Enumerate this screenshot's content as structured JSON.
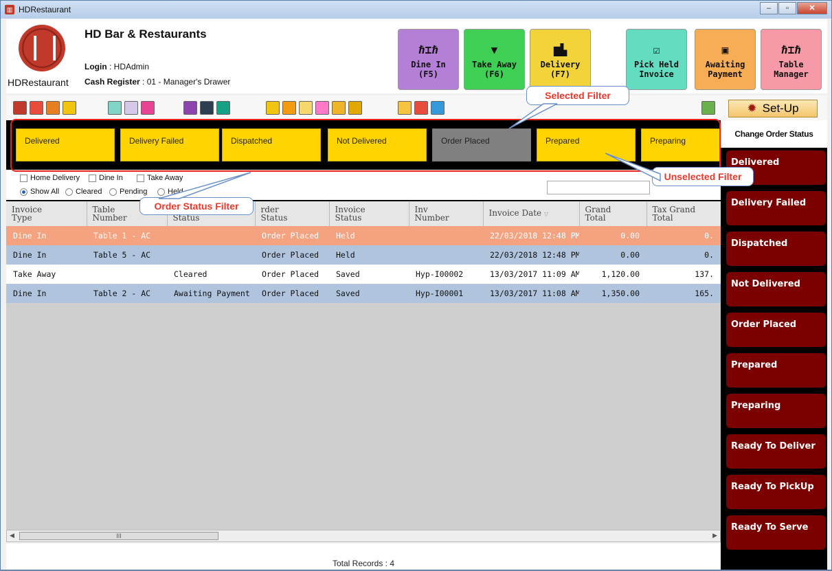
{
  "window": {
    "title": "HDRestaurant",
    "controls": [
      "minimize",
      "maximize",
      "close"
    ]
  },
  "header": {
    "brand": "HDRestaurant",
    "name": "HD Bar & Restaurants",
    "login_label": "Login",
    "login_value": ": HDAdmin",
    "register_label": "Cash Register",
    "register_value": ": 01 - Manager's Drawer",
    "buttons": [
      {
        "line1": "Dine In",
        "line2": "(F5)",
        "color": "#b47fd6",
        "icon": "table-icon"
      },
      {
        "line1": "Take Away",
        "line2": "(F6)",
        "color": "#3fcf54",
        "icon": "cup-icon"
      },
      {
        "line1": "Delivery",
        "line2": "(F7)",
        "color": "#f2d33a",
        "icon": "truck-icon"
      },
      {
        "line1": "Pick Held",
        "line2": "Invoice",
        "color": "#63dcc0",
        "icon": "note-icon"
      },
      {
        "line1": "Awaiting",
        "line2": "Payment",
        "color": "#f6ad56",
        "icon": "wallet-icon"
      },
      {
        "line1": "Table",
        "line2": "Manager",
        "color": "#f59aa6",
        "icon": "table-icon"
      }
    ]
  },
  "toolbar": {
    "setup_label": "Set-Up"
  },
  "filters": [
    "Delivered",
    "Delivery Failed",
    "Dispatched",
    "Not Delivered",
    "Order Placed",
    "Prepared",
    "Preparing"
  ],
  "selected_filter": "Order Placed",
  "options": {
    "checkboxes": [
      "Home Delivery",
      "Dine In",
      "Take Away"
    ],
    "radios": [
      "Show All",
      "Cleared",
      "Pending",
      "Held"
    ],
    "radio_selected": "Show All"
  },
  "table": {
    "columns": [
      "Invoice Type",
      "Table Number",
      "Invoice Status",
      "Order Status",
      "Invoice Status",
      "Inv Number",
      "Invoice Date",
      "Grand Total",
      "Tax Grand Total"
    ],
    "header_visible": [
      "Invoice\nType",
      "Table\nNumber",
      "Status",
      "rder\nStatus",
      "Invoice\nStatus",
      "Inv\nNumber",
      "Invoice Date",
      "Grand\nTotal",
      "Tax Grand\nTotal"
    ],
    "rows": [
      [
        "Dine In",
        "Table 1 - AC",
        "",
        "Order Placed",
        "Held",
        "",
        "22/03/2018 12:48 PM",
        "0.00",
        "0."
      ],
      [
        "Dine In",
        "Table 5 - AC",
        "",
        "Order Placed",
        "Held",
        "",
        "22/03/2018 12:48 PM",
        "0.00",
        "0."
      ],
      [
        "Take Away",
        "",
        "Cleared",
        "Order Placed",
        "Saved",
        "Hyp-I00002",
        "13/03/2017 11:09 AM",
        "1,120.00",
        "137."
      ],
      [
        "Dine In",
        "Table 2 - AC",
        "Awaiting Payment",
        "Order Placed",
        "Saved",
        "Hyp-I00001",
        "13/03/2017 11:08 AM",
        "1,350.00",
        "165."
      ]
    ]
  },
  "status": {
    "total_records": "Total Records : 4"
  },
  "sidebar": {
    "title": "Change Order Status",
    "buttons": [
      "Delivered",
      "Delivery Failed",
      "Dispatched",
      "Not Delivered",
      "Order Placed",
      "Prepared",
      "Preparing",
      "Ready To Deliver",
      "Ready To PickUp",
      "Ready To Serve"
    ]
  },
  "annotations": {
    "selected": "Selected Filter",
    "unselected": "Unselected Filter",
    "order_status": "Order Status Filter"
  }
}
